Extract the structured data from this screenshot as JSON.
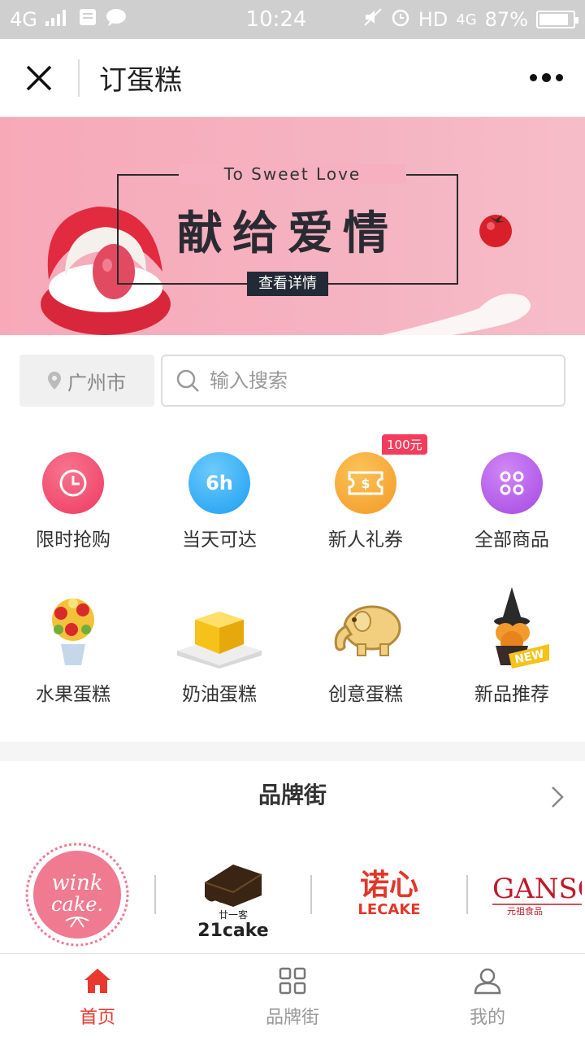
{
  "status_bar": {
    "network": "4G",
    "time": "10:24",
    "hd_label": "HD",
    "network_right": "4G",
    "battery": "87%",
    "battery_level": 0.87
  },
  "header": {
    "title": "订蛋糕"
  },
  "banner": {
    "english": "To Sweet Love",
    "headline": "献给爱情",
    "button": "查看详情"
  },
  "search": {
    "city": "广州市",
    "placeholder": "输入搜索"
  },
  "quick_menu": [
    {
      "label": "限时抢购",
      "icon": "clock-icon",
      "color": "#f2476a"
    },
    {
      "label": "当天可达",
      "icon": "6h-icon",
      "icon_text": "6h",
      "color": "#2faef5"
    },
    {
      "label": "新人礼券",
      "icon": "coupon-icon",
      "badge": "100元",
      "color": "#f7a23a"
    },
    {
      "label": "全部商品",
      "icon": "grid-dots-icon",
      "color": "#b75ee9"
    }
  ],
  "categories": [
    {
      "label": "水果蛋糕",
      "icon": "fruit-bouquet-icon"
    },
    {
      "label": "奶油蛋糕",
      "icon": "cream-cake-icon"
    },
    {
      "label": "创意蛋糕",
      "icon": "elephant-cookie-icon"
    },
    {
      "label": "新品推荐",
      "icon": "new-cupcake-icon",
      "tag": "NEW"
    }
  ],
  "brand_street": {
    "title": "品牌街",
    "brands": [
      {
        "name": "wink cake",
        "line1": "wink",
        "line2": "cake."
      },
      {
        "name": "21cake",
        "line1": "廿一客",
        "line2": "21cake"
      },
      {
        "name": "LECAKE",
        "line1": "诺心",
        "line2": "LECAKE"
      },
      {
        "name": "GANSO",
        "line1": "GANSO",
        "line2": "元祖食品"
      }
    ]
  },
  "tab_bar": {
    "tabs": [
      {
        "label": "首页",
        "icon": "home-icon",
        "active": true
      },
      {
        "label": "品牌街",
        "icon": "grid-icon",
        "active": false
      },
      {
        "label": "我的",
        "icon": "user-icon",
        "active": false
      }
    ],
    "active_color": "#e8382f",
    "inactive_color": "#999999"
  }
}
